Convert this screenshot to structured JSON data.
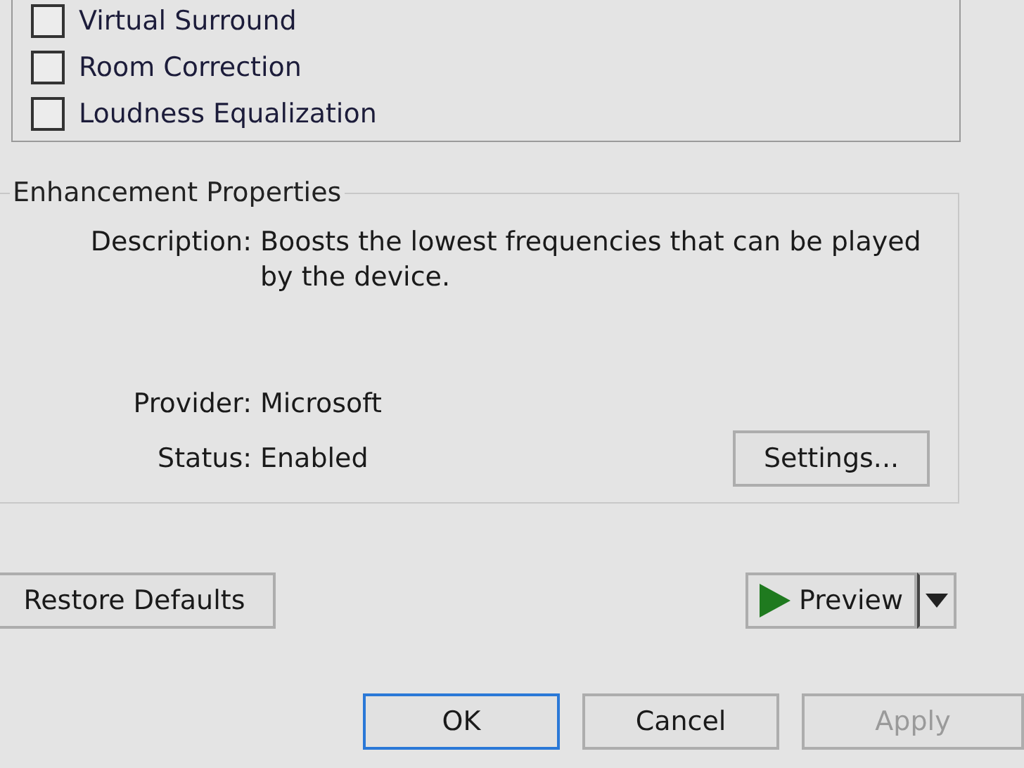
{
  "enhancements": [
    {
      "label": "Virtual Surround",
      "checked": false
    },
    {
      "label": "Room Correction",
      "checked": false
    },
    {
      "label": "Loudness Equalization",
      "checked": false
    }
  ],
  "properties": {
    "title": "Enhancement Properties",
    "fields": [
      {
        "label": "Description:",
        "value": "Boosts the lowest frequencies that can be played by the device."
      },
      {
        "label": "Provider:",
        "value": "Microsoft"
      },
      {
        "label": "Status:",
        "value": "Enabled"
      }
    ],
    "settings_button": "Settings..."
  },
  "restore_button": "Restore Defaults",
  "preview_button": "Preview",
  "dialog_buttons": [
    {
      "label": "OK",
      "focused": true,
      "disabled": false
    },
    {
      "label": "Cancel",
      "focused": false,
      "disabled": false
    },
    {
      "label": "Apply",
      "focused": false,
      "disabled": true
    }
  ]
}
